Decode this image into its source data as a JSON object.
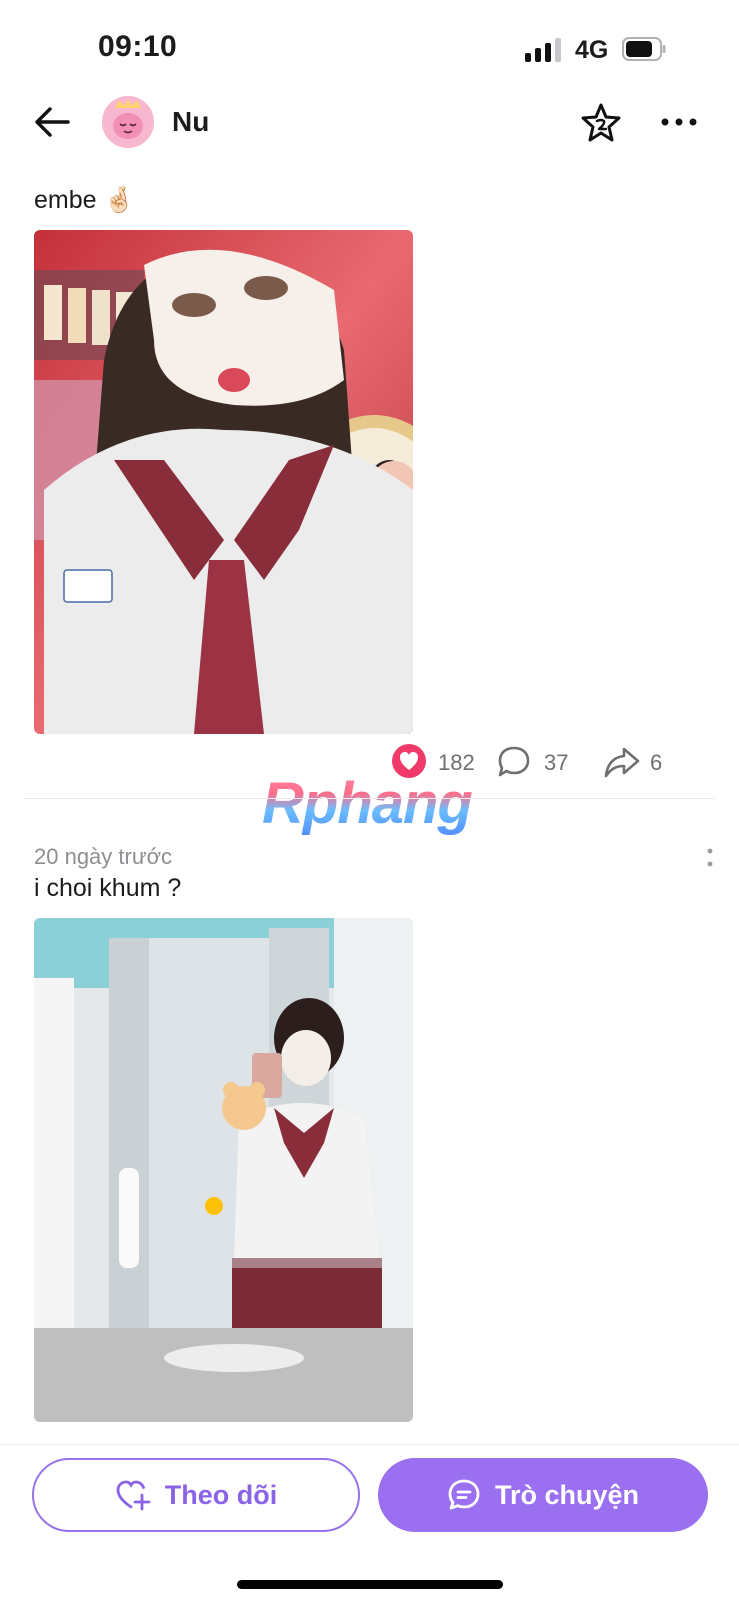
{
  "status_bar": {
    "time": "09:10",
    "network": "4G",
    "signal_bars": 3
  },
  "header": {
    "username": "Nu"
  },
  "posts": [
    {
      "caption": "embe 🤞🏻",
      "likes": "182",
      "comments": "37",
      "shares": "6",
      "watermark": "Rphang"
    },
    {
      "timestamp": "20 ngày trước",
      "caption": "i choi khum ?"
    }
  ],
  "actions": {
    "follow_label": "Theo dõi",
    "chat_label": "Trò chuyện"
  },
  "colors": {
    "accent": "#9a6ff0",
    "like": "#f03b6a",
    "avatar_bg": "#f7b8cf"
  }
}
